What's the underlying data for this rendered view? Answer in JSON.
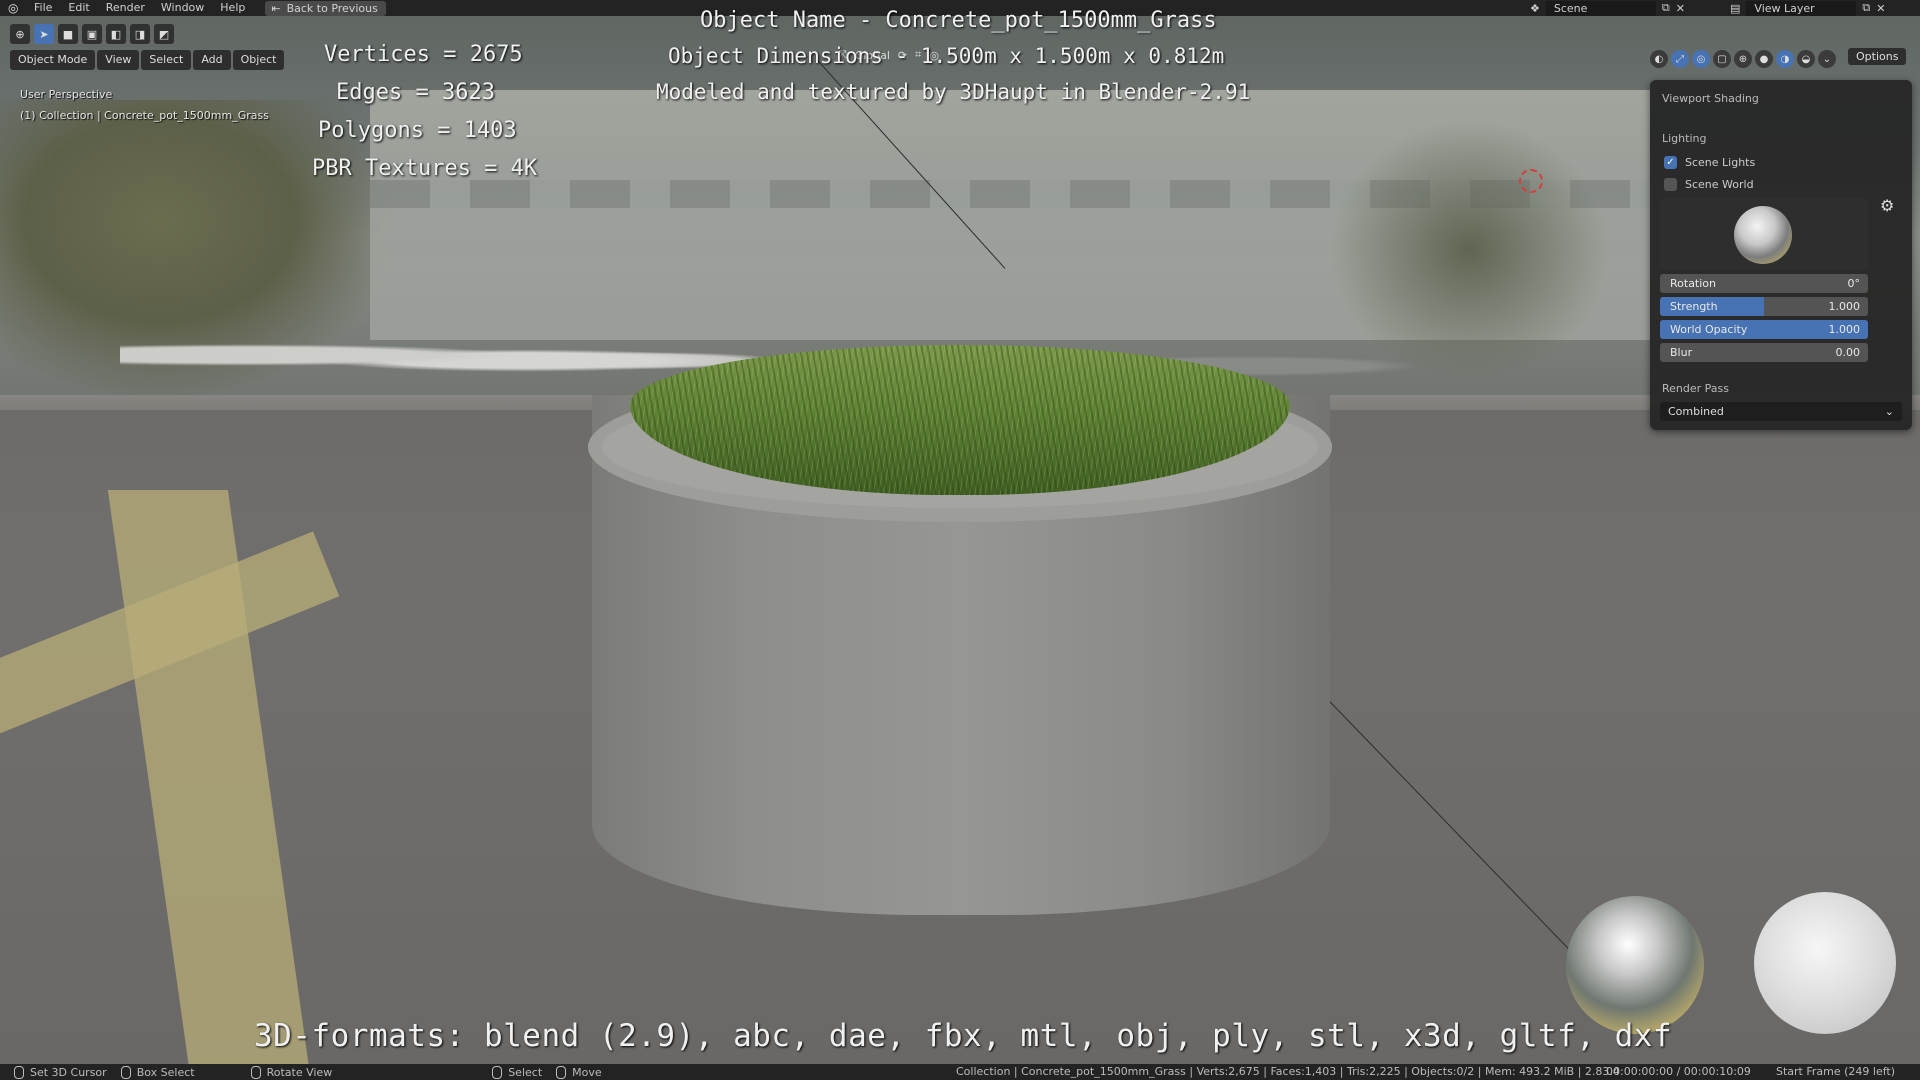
{
  "topbar": {
    "menu": [
      "File",
      "Edit",
      "Render",
      "Window",
      "Help"
    ],
    "back_label": "Back to Previous",
    "scene_label": "Scene",
    "view_layer_label": "View Layer"
  },
  "header": {
    "mode_label": "Object Mode",
    "menu": [
      "View",
      "Select",
      "Add",
      "Object"
    ],
    "orientation_label": "Global",
    "options_label": "Options"
  },
  "viewport": {
    "perspective_label": "User Perspective",
    "collection_label": "(1) Collection | Concrete_pot_1500mm_Grass"
  },
  "overlay": {
    "object_name": "Object Name - Concrete_pot_1500mm_Grass",
    "dimensions": "Object Dimensions -  1.500m x 1.500m x 0.812m",
    "modeled_by": "Modeled and textured by 3DHaupt in Blender-2.91",
    "vertices": "Vertices = 2675",
    "edges": "Edges = 3623",
    "polygons": "Polygons = 1403",
    "pbr": "PBR Textures = 4K",
    "formats": "3D-formats: blend (2.9), abc, dae, fbx, mtl, obj, ply, stl, x3d, gltf, dxf"
  },
  "shading_panel": {
    "title": "Viewport Shading",
    "lighting_label": "Lighting",
    "scene_lights_label": "Scene Lights",
    "scene_lights_checked": true,
    "scene_world_label": "Scene World",
    "scene_world_checked": false,
    "rotation": {
      "label": "Rotation",
      "value": "0°",
      "fraction": 0
    },
    "strength": {
      "label": "Strength",
      "value": "1.000",
      "fraction": 0.5
    },
    "world_opacity": {
      "label": "World Opacity",
      "value": "1.000",
      "fraction": 1.0
    },
    "blur": {
      "label": "Blur",
      "value": "0.00",
      "fraction": 0
    },
    "render_pass_label": "Render Pass",
    "render_pass_value": "Combined"
  },
  "statusbar": {
    "set_cursor": "Set 3D Cursor",
    "box_select": "Box Select",
    "rotate_view": "Rotate View",
    "select": "Select",
    "move": "Move",
    "stats": "Collection | Concrete_pot_1500mm_Grass | Verts:2,675 | Faces:1,403 | Tris:2,225 | Objects:0/2 | Mem: 493.2 MiB | 2.83.4",
    "time": "00:00:00:00 / 00:00:10:09",
    "frame": "Start Frame (249 left)"
  },
  "colors": {
    "accent": "#4772b3",
    "panel_bg": "#262626",
    "bar_bg": "#232323"
  }
}
